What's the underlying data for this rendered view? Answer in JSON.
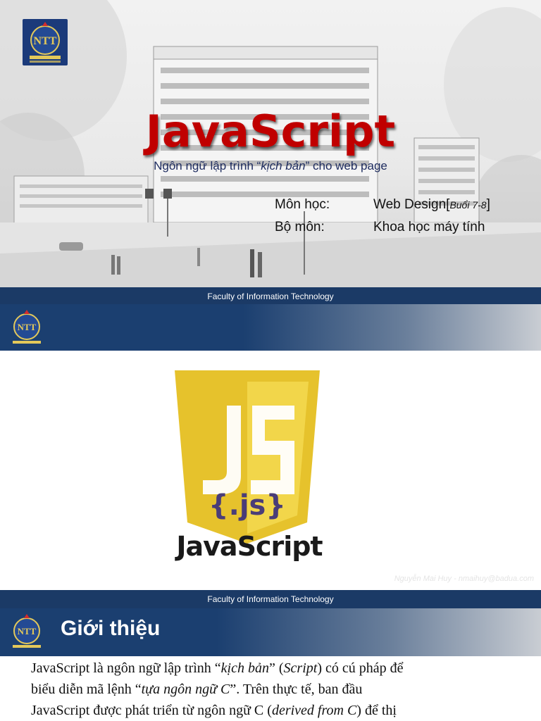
{
  "slide1": {
    "title": "JavaScript",
    "subtitle_pre": "Ngôn ngữ lập trình “",
    "subtitle_em": "kịch bản",
    "subtitle_post": "” cho web page",
    "course_label": "Môn học:",
    "course_value": "Web Design[",
    "course_session": "Buổi 7-8",
    "course_close": "]",
    "dept_label": "Bộ môn:",
    "dept_value": "Khoa học máy tính",
    "footer": "Faculty of Information Technology"
  },
  "slide2": {
    "js_badge": "{.js}",
    "js_word": "JavaScript",
    "watermark": "Nguyễn Mai Huy - nmaihuy@badua.com",
    "footer": "Faculty of Information Technology"
  },
  "slide3": {
    "heading": "Giới thiệu",
    "line1_a": "JavaScript là ngôn ngữ lập trình “",
    "line1_b": "kịch bản",
    "line1_c": "” (",
    "line1_d": "Script",
    "line1_e": ") có cú pháp để",
    "line2_a": "biểu diễn mã lệnh “",
    "line2_b": "tựa ngôn ngữ C",
    "line2_c": "”. Trên thực tế, ban đầu",
    "line3_a": "JavaScript được phát triển từ ngôn ngữ C (",
    "line3_b": "derived from C",
    "line3_c": ") để thị"
  },
  "colors": {
    "title_red": "#c00000",
    "banner_blue": "#1b3a66",
    "js_yellow": "#f0d232",
    "js_badge_purple": "#4a3d78"
  },
  "icons": [
    "university-logo",
    "javascript-shield-logo"
  ]
}
